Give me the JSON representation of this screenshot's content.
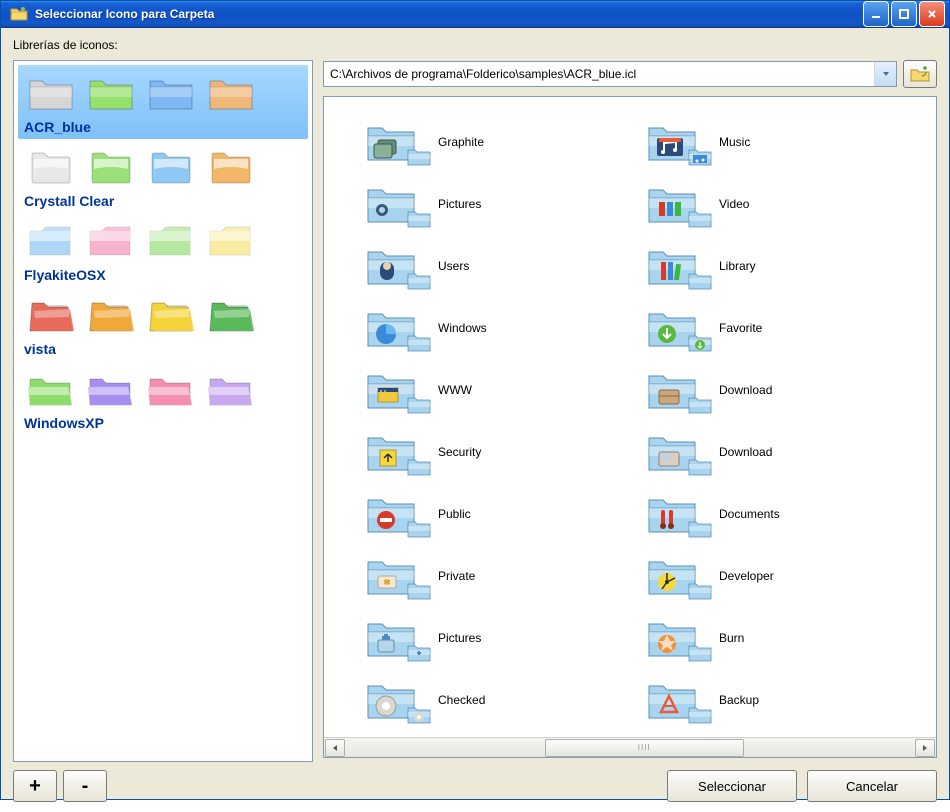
{
  "window": {
    "title": "Seleccionar Icono para Carpeta"
  },
  "labels": {
    "libraries": "Librerías de iconos:"
  },
  "path": "C:\\Archivos de programa\\Folderico\\samples\\ACR_blue.icl",
  "buttons": {
    "add": "+",
    "remove": "-",
    "select": "Seleccionar",
    "cancel": "Cancelar"
  },
  "libraries": [
    {
      "name": "ACR_blue",
      "colors": [
        "#d6d6d6",
        "#96e06c",
        "#7fb9f3",
        "#f0b77a"
      ],
      "selected": true
    },
    {
      "name": "Crystall Clear",
      "colors": [
        "#e8e8e8",
        "#9be07a",
        "#8ec8f5",
        "#f3b76a"
      ],
      "selected": false,
      "glossy": true
    },
    {
      "name": "FlyakiteOSX",
      "colors": [
        "#8ec8f5",
        "#f593b8",
        "#9be07a",
        "#f5e47a"
      ],
      "selected": false,
      "osx": true
    },
    {
      "name": "vista",
      "colors": [
        "#e86a5a",
        "#f0a93a",
        "#f5d43a",
        "#5ab85a"
      ],
      "selected": false,
      "vista": true
    },
    {
      "name": "WindowsXP",
      "colors": [
        "#8edc6a",
        "#a78ef0",
        "#f58eb0",
        "#c8a8f0"
      ],
      "selected": false,
      "xp": true
    }
  ],
  "icons": [
    {
      "label": "Graphite",
      "overlay": "graphite"
    },
    {
      "label": "Music",
      "overlay": "music"
    },
    {
      "label": "Pictures",
      "overlay": "pictures"
    },
    {
      "label": "Video",
      "overlay": "video"
    },
    {
      "label": "Users",
      "overlay": "users"
    },
    {
      "label": "Library",
      "overlay": "library"
    },
    {
      "label": "Windows",
      "overlay": "windows"
    },
    {
      "label": "Favorite",
      "overlay": "favorite"
    },
    {
      "label": "WWW",
      "overlay": "www"
    },
    {
      "label": "Download",
      "overlay": "download"
    },
    {
      "label": "Security",
      "overlay": "security"
    },
    {
      "label": "Download",
      "overlay": "download2"
    },
    {
      "label": "Public",
      "overlay": "public"
    },
    {
      "label": "Documents",
      "overlay": "documents"
    },
    {
      "label": "Private",
      "overlay": "private"
    },
    {
      "label": "Developer",
      "overlay": "developer"
    },
    {
      "label": "Pictures",
      "overlay": "pictures2"
    },
    {
      "label": "Burn",
      "overlay": "burn"
    },
    {
      "label": "Checked",
      "overlay": "checked"
    },
    {
      "label": "Backup",
      "overlay": "backup"
    }
  ]
}
